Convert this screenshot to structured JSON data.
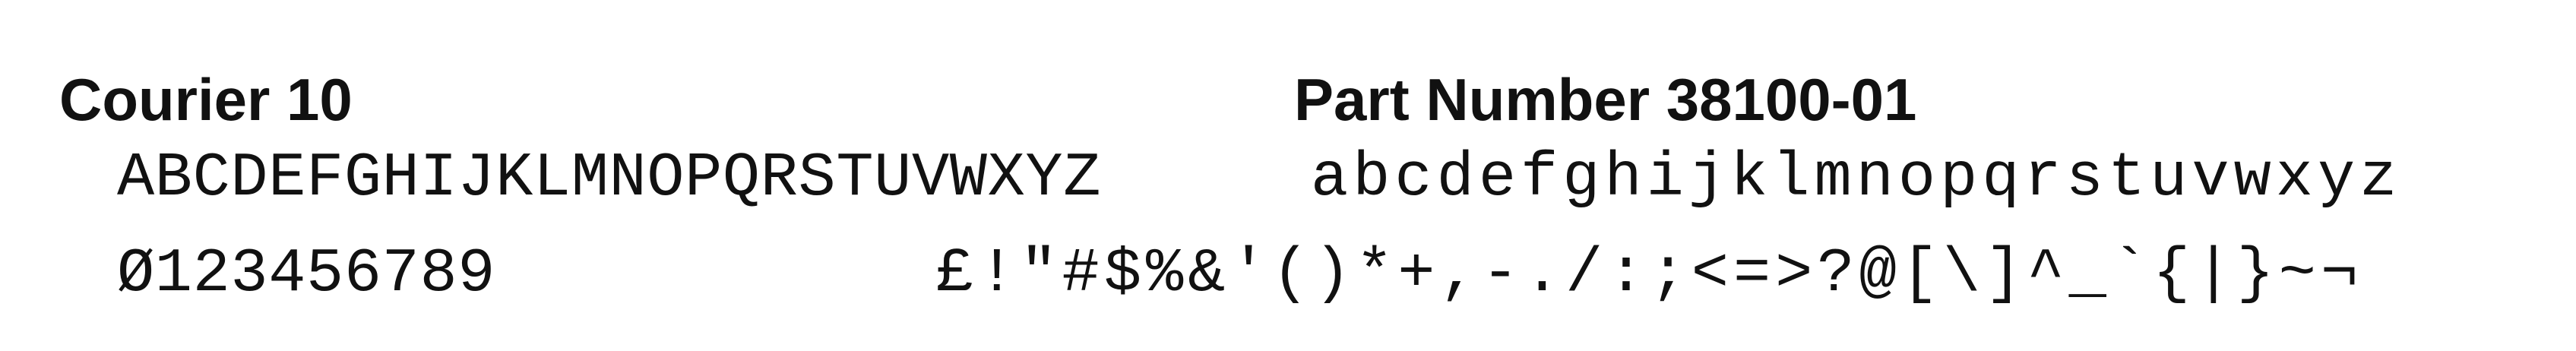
{
  "header": {
    "font_name": "Courier 10",
    "part_number": "Part Number 38100-01"
  },
  "samples": {
    "uppercase": "ABCDEFGHIJKLMNOPQRSTUVWXYZ",
    "lowercase": "abcdefghijklmnopqrstuvwxyz",
    "digits": "Ø123456789",
    "symbols": "£!\"#$%&'()*+,-./:;<=>?@[\\]^_`{|}~¬"
  },
  "colors": {
    "ink": "#111111",
    "paper": "#ffffff"
  }
}
